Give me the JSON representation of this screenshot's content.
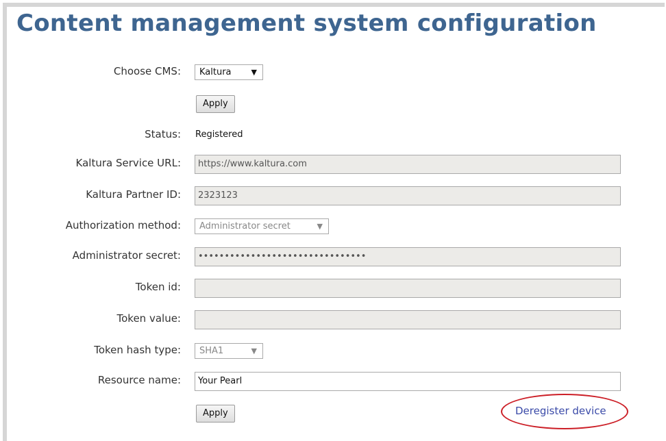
{
  "page": {
    "title": "Content management system configuration"
  },
  "form": {
    "choose_cms_label": "Choose CMS:",
    "choose_cms_value": "Kaltura",
    "apply_label": "Apply",
    "status_label": "Status:",
    "status_value": "Registered",
    "service_url_label": "Kaltura Service URL:",
    "service_url_value": "https://www.kaltura.com",
    "partner_id_label": "Kaltura Partner ID:",
    "partner_id_value": "2323123",
    "auth_method_label": "Authorization method:",
    "auth_method_value": "Administrator secret",
    "admin_secret_label": "Administrator secret:",
    "admin_secret_value": "••••••••••••••••••••••••••••••••",
    "token_id_label": "Token id:",
    "token_id_value": "",
    "token_value_label": "Token value:",
    "token_value_value": "",
    "token_hash_label": "Token hash type:",
    "token_hash_value": "SHA1",
    "resource_name_label": "Resource name:",
    "resource_name_value": "Your Pearl",
    "apply_bottom_label": "Apply",
    "deregister_label": "Deregister device"
  },
  "icons": {
    "dropdown": "▼"
  },
  "colors": {
    "title": "#3e6590",
    "link": "#3a4aa8",
    "highlight_oval": "#cc1f27"
  }
}
